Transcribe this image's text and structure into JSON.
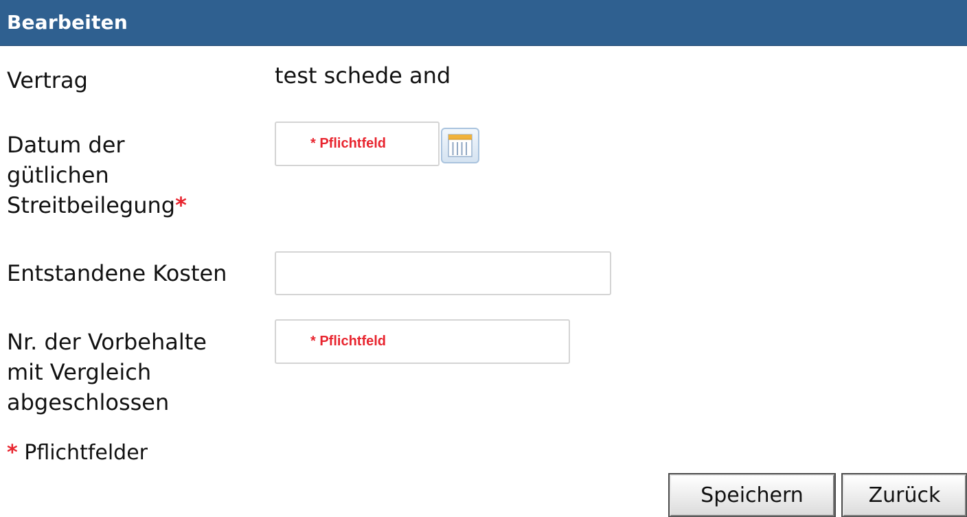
{
  "header": {
    "title": "Bearbeiten"
  },
  "form": {
    "contract": {
      "label": "Vertrag",
      "value": "test schede and"
    },
    "settlement_date": {
      "label_lines": [
        "Datum der",
        "gütlichen",
        "Streitbeilegung"
      ],
      "required_mark": "*",
      "value": "",
      "placeholder": "* Pflichtfeld"
    },
    "costs": {
      "label": "Entstandene Kosten",
      "value": "",
      "placeholder": ""
    },
    "reservations_settled": {
      "label_lines": [
        "Nr. der Vorbehalte",
        "mit Vergleich",
        "abgeschlossen"
      ],
      "value": "",
      "placeholder": "* Pflichtfeld"
    },
    "footnote": {
      "star": "*",
      "text": " Pflichtfelder"
    }
  },
  "buttons": {
    "save_label": "Speichern",
    "back_label": "Zurück"
  },
  "icons": {
    "calendar": "calendar-icon"
  },
  "colors": {
    "header_bg": "#2f6090",
    "required": "#e8252f"
  }
}
